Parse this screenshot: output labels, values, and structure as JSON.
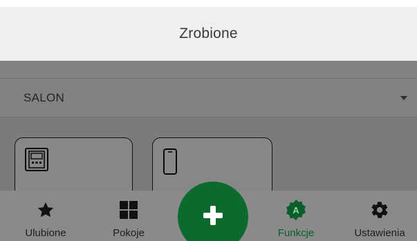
{
  "header": {
    "title": "Zrobione"
  },
  "room_selector": {
    "value": "SALON"
  },
  "devices": [
    {
      "icon": "control-panel-icon"
    },
    {
      "icon": "phone-device-icon"
    }
  ],
  "nav": {
    "favorites": "Ulubione",
    "rooms": "Pokoje",
    "functions": "Funkcje",
    "settings": "Ustawienia"
  },
  "colors": {
    "accent_green": "#0c6a2f",
    "active_label": "#0d5e2c"
  }
}
